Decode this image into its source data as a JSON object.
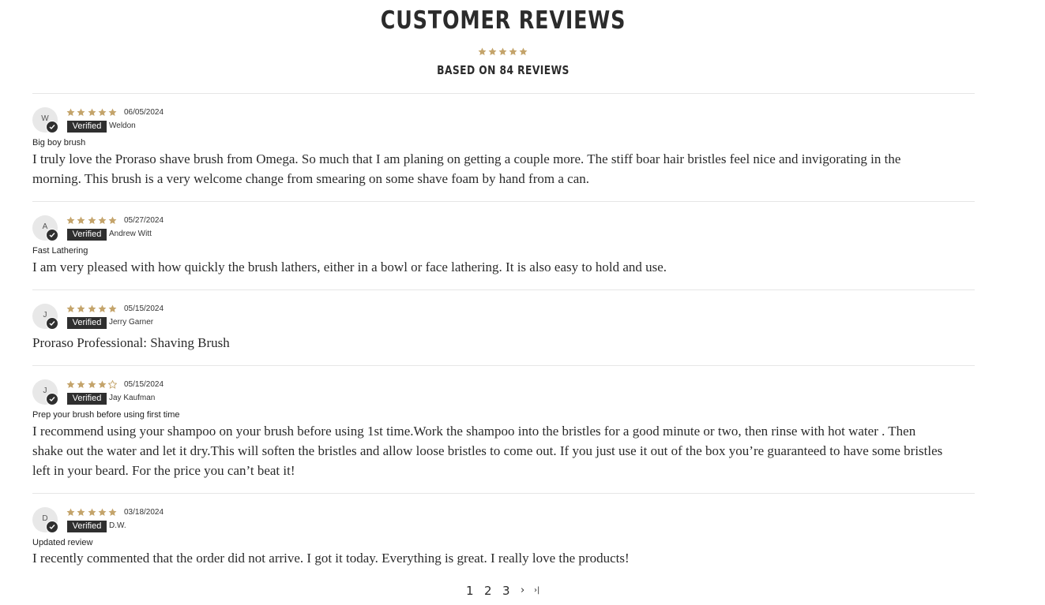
{
  "header": {
    "title": "CUSTOMER REVIEWS",
    "rating": 5,
    "based_on": "BASED ON 84 REVIEWS"
  },
  "colors": {
    "star": "#c4a46b",
    "badge": "#2f2f2f",
    "divider": "#e6e6e6"
  },
  "reviews": [
    {
      "initial": "W",
      "rating": 5,
      "date": "06/05/2024",
      "badge": "Verified",
      "author": "Weldon",
      "title": "Big boy brush",
      "body_lines": [
        "I truly love the Proraso shave brush from Omega. So much that I am planing on getting a couple more. The stiff boar hair bristles feel nice and invigorating in the",
        "morning. This brush is a very welcome change from smearing on some shave foam by hand from a can."
      ]
    },
    {
      "initial": "A",
      "rating": 5,
      "date": "05/27/2024",
      "badge": "Verified",
      "author": "Andrew Witt",
      "title": "Fast Lathering",
      "body_lines": [
        "I am very pleased with how quickly the brush lathers, either in a bowl or face lathering. It is also easy to hold and use."
      ]
    },
    {
      "initial": "J",
      "rating": 5,
      "date": "05/15/2024",
      "badge": "Verified",
      "author": "Jerry Garner",
      "title": "",
      "body_lines": [
        "Proraso Professional: Shaving Brush"
      ]
    },
    {
      "initial": "J",
      "rating": 4,
      "date": "05/15/2024",
      "badge": "Verified",
      "author": "Jay Kaufman",
      "title": "Prep your brush before using first time",
      "body_lines": [
        "I recommend using your shampoo on your brush before using 1st time.Work the shampoo into the bristles for a good minute or two, then rinse with hot water . Then",
        "shake out the water and let it dry.This will soften the bristles and allow loose bristles to come out. If you just use it out of the box you’re guaranteed to have some bristles",
        "left in your beard. For the price you can’t beat it!"
      ]
    },
    {
      "initial": "D",
      "rating": 5,
      "date": "03/18/2024",
      "badge": "Verified",
      "author": "D.W.",
      "title": "Updated review",
      "body_lines": [
        "I recently commented that the order did not arrive. I got it today. Everything is great. I really love the products!"
      ]
    }
  ],
  "pagination": {
    "pages": [
      "1",
      "2",
      "3"
    ],
    "next": "›",
    "last": "›|"
  }
}
